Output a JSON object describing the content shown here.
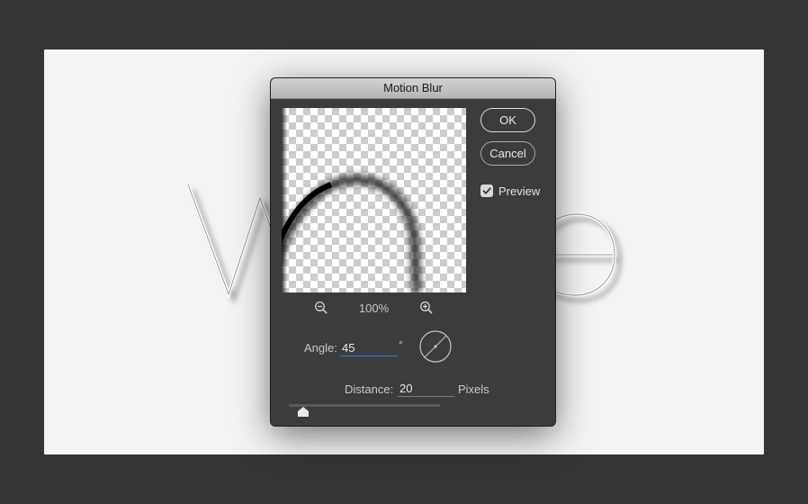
{
  "dialog": {
    "title": "Motion Blur",
    "ok_label": "OK",
    "cancel_label": "Cancel",
    "preview_label": "Preview",
    "preview_checked": true,
    "zoom_level": "100%",
    "angle_label": "Angle:",
    "angle_value": "45",
    "angle_unit": "°",
    "distance_label": "Distance:",
    "distance_value": "20",
    "distance_unit": "Pixels"
  },
  "colors": {
    "window_bg": "#353535",
    "canvas_bg": "#f4f4f4",
    "dialog_bg": "#3c3c3c",
    "focus_accent": "#2d7ce0"
  },
  "icons": [
    "zoom-out-icon",
    "zoom-in-icon",
    "checkmark-icon",
    "angle-dial-icon",
    "slider-thumb-icon"
  ]
}
